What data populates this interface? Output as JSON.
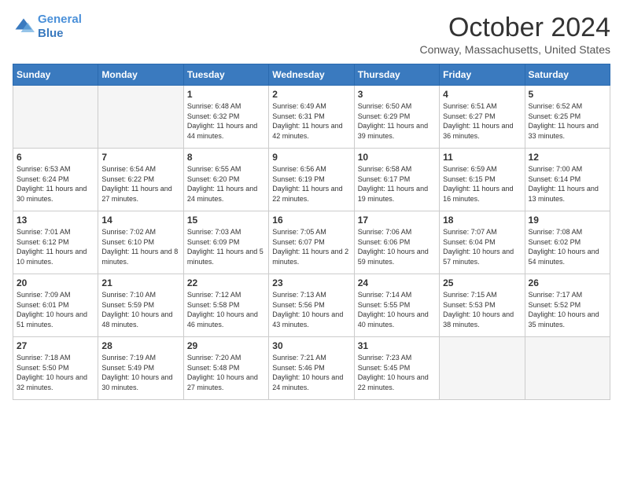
{
  "header": {
    "logo_line1": "General",
    "logo_line2": "Blue",
    "month": "October 2024",
    "location": "Conway, Massachusetts, United States"
  },
  "days_of_week": [
    "Sunday",
    "Monday",
    "Tuesday",
    "Wednesday",
    "Thursday",
    "Friday",
    "Saturday"
  ],
  "weeks": [
    [
      {
        "num": "",
        "empty": true
      },
      {
        "num": "",
        "empty": true
      },
      {
        "num": "1",
        "sunrise": "6:48 AM",
        "sunset": "6:32 PM",
        "daylight": "11 hours and 44 minutes."
      },
      {
        "num": "2",
        "sunrise": "6:49 AM",
        "sunset": "6:31 PM",
        "daylight": "11 hours and 42 minutes."
      },
      {
        "num": "3",
        "sunrise": "6:50 AM",
        "sunset": "6:29 PM",
        "daylight": "11 hours and 39 minutes."
      },
      {
        "num": "4",
        "sunrise": "6:51 AM",
        "sunset": "6:27 PM",
        "daylight": "11 hours and 36 minutes."
      },
      {
        "num": "5",
        "sunrise": "6:52 AM",
        "sunset": "6:25 PM",
        "daylight": "11 hours and 33 minutes."
      }
    ],
    [
      {
        "num": "6",
        "sunrise": "6:53 AM",
        "sunset": "6:24 PM",
        "daylight": "11 hours and 30 minutes."
      },
      {
        "num": "7",
        "sunrise": "6:54 AM",
        "sunset": "6:22 PM",
        "daylight": "11 hours and 27 minutes."
      },
      {
        "num": "8",
        "sunrise": "6:55 AM",
        "sunset": "6:20 PM",
        "daylight": "11 hours and 24 minutes."
      },
      {
        "num": "9",
        "sunrise": "6:56 AM",
        "sunset": "6:19 PM",
        "daylight": "11 hours and 22 minutes."
      },
      {
        "num": "10",
        "sunrise": "6:58 AM",
        "sunset": "6:17 PM",
        "daylight": "11 hours and 19 minutes."
      },
      {
        "num": "11",
        "sunrise": "6:59 AM",
        "sunset": "6:15 PM",
        "daylight": "11 hours and 16 minutes."
      },
      {
        "num": "12",
        "sunrise": "7:00 AM",
        "sunset": "6:14 PM",
        "daylight": "11 hours and 13 minutes."
      }
    ],
    [
      {
        "num": "13",
        "sunrise": "7:01 AM",
        "sunset": "6:12 PM",
        "daylight": "11 hours and 10 minutes."
      },
      {
        "num": "14",
        "sunrise": "7:02 AM",
        "sunset": "6:10 PM",
        "daylight": "11 hours and 8 minutes."
      },
      {
        "num": "15",
        "sunrise": "7:03 AM",
        "sunset": "6:09 PM",
        "daylight": "11 hours and 5 minutes."
      },
      {
        "num": "16",
        "sunrise": "7:05 AM",
        "sunset": "6:07 PM",
        "daylight": "11 hours and 2 minutes."
      },
      {
        "num": "17",
        "sunrise": "7:06 AM",
        "sunset": "6:06 PM",
        "daylight": "10 hours and 59 minutes."
      },
      {
        "num": "18",
        "sunrise": "7:07 AM",
        "sunset": "6:04 PM",
        "daylight": "10 hours and 57 minutes."
      },
      {
        "num": "19",
        "sunrise": "7:08 AM",
        "sunset": "6:02 PM",
        "daylight": "10 hours and 54 minutes."
      }
    ],
    [
      {
        "num": "20",
        "sunrise": "7:09 AM",
        "sunset": "6:01 PM",
        "daylight": "10 hours and 51 minutes."
      },
      {
        "num": "21",
        "sunrise": "7:10 AM",
        "sunset": "5:59 PM",
        "daylight": "10 hours and 48 minutes."
      },
      {
        "num": "22",
        "sunrise": "7:12 AM",
        "sunset": "5:58 PM",
        "daylight": "10 hours and 46 minutes."
      },
      {
        "num": "23",
        "sunrise": "7:13 AM",
        "sunset": "5:56 PM",
        "daylight": "10 hours and 43 minutes."
      },
      {
        "num": "24",
        "sunrise": "7:14 AM",
        "sunset": "5:55 PM",
        "daylight": "10 hours and 40 minutes."
      },
      {
        "num": "25",
        "sunrise": "7:15 AM",
        "sunset": "5:53 PM",
        "daylight": "10 hours and 38 minutes."
      },
      {
        "num": "26",
        "sunrise": "7:17 AM",
        "sunset": "5:52 PM",
        "daylight": "10 hours and 35 minutes."
      }
    ],
    [
      {
        "num": "27",
        "sunrise": "7:18 AM",
        "sunset": "5:50 PM",
        "daylight": "10 hours and 32 minutes."
      },
      {
        "num": "28",
        "sunrise": "7:19 AM",
        "sunset": "5:49 PM",
        "daylight": "10 hours and 30 minutes."
      },
      {
        "num": "29",
        "sunrise": "7:20 AM",
        "sunset": "5:48 PM",
        "daylight": "10 hours and 27 minutes."
      },
      {
        "num": "30",
        "sunrise": "7:21 AM",
        "sunset": "5:46 PM",
        "daylight": "10 hours and 24 minutes."
      },
      {
        "num": "31",
        "sunrise": "7:23 AM",
        "sunset": "5:45 PM",
        "daylight": "10 hours and 22 minutes."
      },
      {
        "num": "",
        "empty": true
      },
      {
        "num": "",
        "empty": true
      }
    ]
  ]
}
